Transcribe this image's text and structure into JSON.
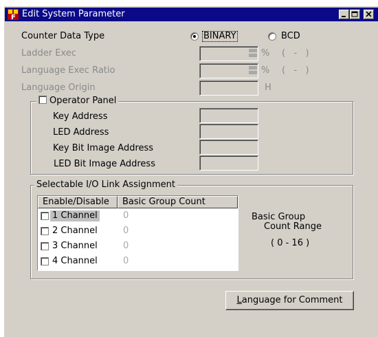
{
  "window": {
    "title": "Edit System Parameter"
  },
  "counter_data_type": {
    "label": "Counter Data Type",
    "options": [
      {
        "label": "BINARY",
        "selected": true
      },
      {
        "label": "BCD",
        "selected": false
      }
    ]
  },
  "ladder_exec": {
    "label": "Ladder Exec",
    "value": "",
    "unit": "%",
    "range": "(   -   )"
  },
  "language_exec_ratio": {
    "label": "Language Exec Ratio",
    "value": "",
    "unit": "%",
    "range": "(   -   )"
  },
  "language_origin": {
    "label": "Language Origin",
    "value": "",
    "unit": "H"
  },
  "operator_panel": {
    "label": "Operator Panel",
    "checked": false,
    "fields": [
      {
        "label": "Key Address",
        "value": ""
      },
      {
        "label": "LED Address",
        "value": ""
      },
      {
        "label": "Key Bit Image Address",
        "value": ""
      },
      {
        "label": "LED Bit Image Address",
        "value": ""
      }
    ]
  },
  "io_link": {
    "label": "Selectable I/O Link Assignment",
    "columns": [
      "Enable/Disable",
      "Basic Group Count"
    ],
    "rows": [
      {
        "channel": "1 Channel",
        "count": "0",
        "enabled": false,
        "selected": true
      },
      {
        "channel": "2 Channel",
        "count": "0",
        "enabled": false,
        "selected": false
      },
      {
        "channel": "3 Channel",
        "count": "0",
        "enabled": false,
        "selected": false
      },
      {
        "channel": "4 Channel",
        "count": "0",
        "enabled": false,
        "selected": false
      }
    ],
    "range_title_1": "Basic Group",
    "range_title_2": "Count Range",
    "range_value": "( 0 - 16 )"
  },
  "buttons": {
    "language_for_comment": "Language for Comment"
  },
  "icons": {
    "app": "app-f-icon",
    "minimize": "minimize-icon",
    "maximize": "maximize-icon",
    "close": "close-icon"
  },
  "colors": {
    "titlebar": "#0a0a88",
    "face": "#d4d0c8",
    "disabled_text": "#8a8a8a"
  }
}
